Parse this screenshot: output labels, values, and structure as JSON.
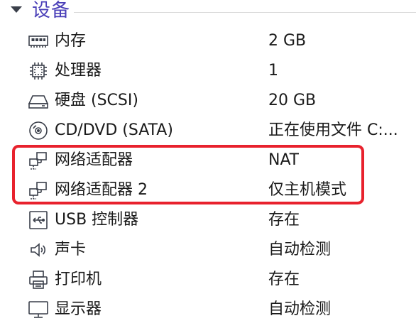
{
  "section": {
    "title": "设备",
    "arrow_icon": "triangle-down-icon"
  },
  "devices": [
    {
      "icon": "memory-icon",
      "name": "内存",
      "value": "2 GB"
    },
    {
      "icon": "processor-icon",
      "name": "处理器",
      "value": "1"
    },
    {
      "icon": "hard-disk-icon",
      "name": "硬盘 (SCSI)",
      "value": "20 GB"
    },
    {
      "icon": "cd-dvd-icon",
      "name": "CD/DVD (SATA)",
      "value": "正在使用文件 C:..."
    },
    {
      "icon": "network-adapter-icon",
      "name": "网络适配器",
      "value": "NAT"
    },
    {
      "icon": "network-adapter-icon",
      "name": "网络适配器 2",
      "value": "仅主机模式"
    },
    {
      "icon": "usb-controller-icon",
      "name": "USB 控制器",
      "value": "存在"
    },
    {
      "icon": "sound-card-icon",
      "name": "声卡",
      "value": "自动检测"
    },
    {
      "icon": "printer-icon",
      "name": "打印机",
      "value": "存在"
    },
    {
      "icon": "display-icon",
      "name": "显示器",
      "value": "自动检测"
    }
  ],
  "colors": {
    "title": "#4a3fb8",
    "highlight": "#e8222d",
    "icon": "#3a3f4a"
  }
}
